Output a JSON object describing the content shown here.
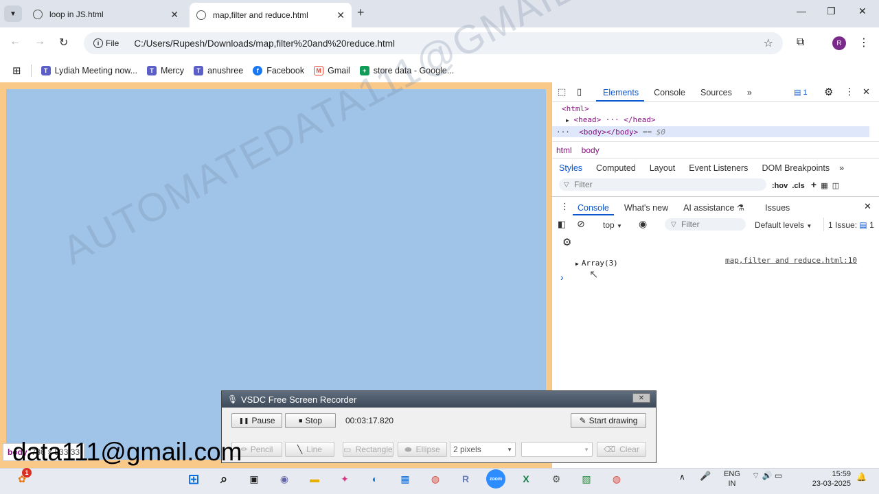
{
  "browser": {
    "tabs": [
      {
        "title": "loop in JS.html",
        "active": false
      },
      {
        "title": "map,filter and reduce.html",
        "active": true
      }
    ],
    "new_tab_icon": "+",
    "window_controls": {
      "minimize": "—",
      "maximize": "❐",
      "close": "✕"
    },
    "omnibox": {
      "scheme_label": "File",
      "url": "C:/Users/Rupesh/Downloads/map,filter%20and%20reduce.html"
    },
    "profile_initial": "R",
    "bookmarks": [
      {
        "label": "Lydiah Meeting now...",
        "icon": "teams-icon",
        "color": "#5b5fc7"
      },
      {
        "label": "Mercy",
        "icon": "teams-icon",
        "color": "#5b5fc7"
      },
      {
        "label": "anushree",
        "icon": "teams-icon",
        "color": "#5b5fc7"
      },
      {
        "label": "Facebook",
        "icon": "facebook-icon",
        "color": "#1877f2"
      },
      {
        "label": "Gmail",
        "icon": "gmail-icon",
        "color": "#ea4335"
      },
      {
        "label": "store data - Google...",
        "icon": "sheets-icon",
        "color": "#0f9d58"
      }
    ]
  },
  "devtools": {
    "main_tabs": [
      "Elements",
      "Console",
      "Sources"
    ],
    "issues_count": "1",
    "dom": {
      "html": "<html>",
      "head": "<head> ··· </head>",
      "body": "<body></body>",
      "selected_marker": "== $0"
    },
    "breadcrumbs": [
      "html",
      "body"
    ],
    "styles_tabs": [
      "Styles",
      "Computed",
      "Layout",
      "Event Listeners",
      "DOM Breakpoints"
    ],
    "styles_filter_placeholder": "Filter",
    "styles_tools": [
      ":hov",
      ".cls"
    ],
    "drawer_tabs": [
      "Console",
      "What's new",
      "AI assistance",
      "Issues"
    ],
    "console_toolbar": {
      "context": "top",
      "filter_placeholder": "Filter",
      "levels": "Default levels",
      "issues": "1 Issue:",
      "issues_count": "1"
    },
    "console_messages": [
      {
        "text": "Array(3)",
        "source": "map,filter and reduce.html:10"
      }
    ],
    "prompt": "›"
  },
  "recorder": {
    "title": "VSDC Free Screen Recorder",
    "pause_label": "Pause",
    "stop_label": "Stop",
    "time": "00:03:17.820",
    "start_drawing_label": "Start drawing",
    "tools": [
      "Pencil",
      "Line",
      "Rectangle",
      "Ellipse"
    ],
    "thickness": "2 pixels",
    "clear_label": "Clear"
  },
  "overlay": {
    "email_text": "data111@gmail.com",
    "tooltip_tag": "body",
    "tooltip_size": "786 × 533.33"
  },
  "watermark": "AUTOMATEDATA111@GMAIL.COM",
  "taskbar": {
    "notification_badge": "1",
    "language_line1": "ENG",
    "language_line2": "IN",
    "time": "15:59",
    "date": "23-03-2025"
  }
}
